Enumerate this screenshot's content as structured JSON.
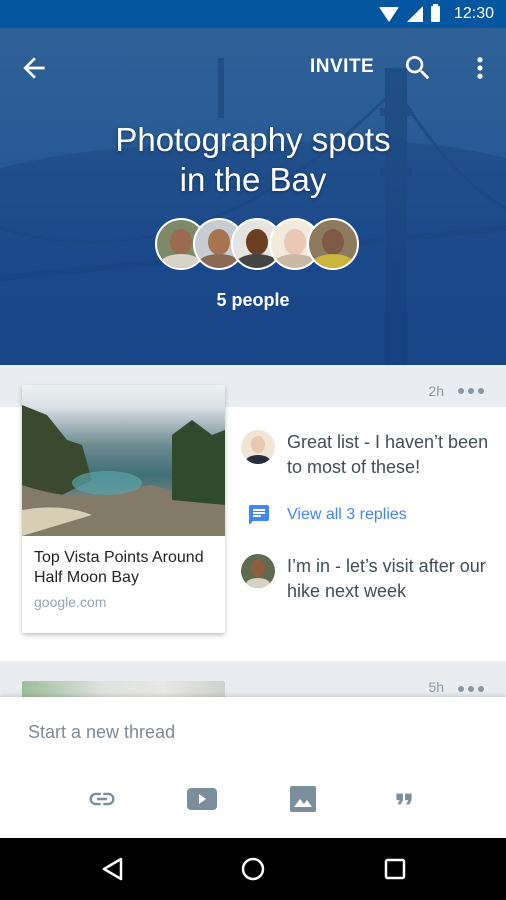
{
  "status_bar": {
    "time": "12:30",
    "icons": [
      "wifi-icon",
      "cell-signal-icon",
      "battery-icon"
    ]
  },
  "app_bar": {
    "back_icon": "arrow-back-icon",
    "invite_label": "INVITE",
    "search_icon": "search-icon",
    "more_icon": "more-vert-icon"
  },
  "group": {
    "title_line1": "Photography spots",
    "title_line2": "in the Bay",
    "people_count": "5 people",
    "member_count": 5
  },
  "threads": [
    {
      "time": "2h",
      "link": {
        "title": "Top Vista Points Around Half Moon Bay",
        "domain": "google.com"
      },
      "comments": [
        {
          "text": "Great list - I haven’t been to most of these!"
        },
        {
          "text": "I’m in - let’s visit after our hike next week"
        }
      ],
      "replies_label": "View all 3 replies",
      "replies_icon": "message-icon"
    },
    {
      "time": "5h"
    }
  ],
  "composer": {
    "placeholder": "Start a new thread",
    "tools": [
      "link-icon",
      "video-icon",
      "image-icon",
      "quote-icon"
    ]
  },
  "nav_bar": {
    "buttons": [
      "back-triangle-icon",
      "home-circle-icon",
      "recents-square-icon"
    ]
  },
  "colors": {
    "status_bar": "#03569f",
    "header_blue": "#1f4f94",
    "feed_bg": "#e9edf1",
    "link_blue": "#4285f4",
    "icon_gray": "#7a8e9c",
    "text_dark": "#3f4d57"
  }
}
